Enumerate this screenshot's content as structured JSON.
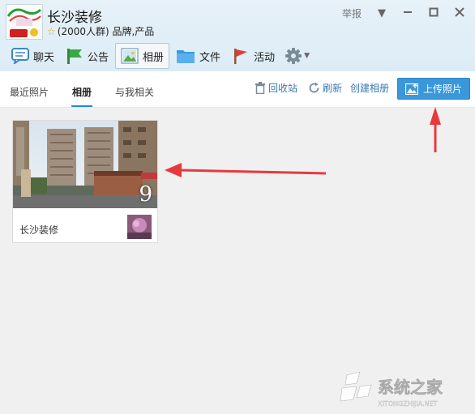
{
  "header": {
    "group_name": "长沙装修",
    "group_meta": "(2000人群) 品牌,产品",
    "report_label": "举报"
  },
  "toolbar": {
    "items": [
      {
        "label": "聊天"
      },
      {
        "label": "公告"
      },
      {
        "label": "相册"
      },
      {
        "label": "文件"
      },
      {
        "label": "活动"
      }
    ]
  },
  "subnav": {
    "tabs": [
      {
        "label": "最近照片"
      },
      {
        "label": "相册"
      },
      {
        "label": "与我相关"
      }
    ],
    "actions": {
      "recycle": "回收站",
      "refresh": "刷新",
      "create_album": "创建相册",
      "upload": "上传照片"
    }
  },
  "albums": [
    {
      "title": "长沙装修",
      "count": "9"
    }
  ],
  "watermark": {
    "logo_text": "系统之家",
    "logo_subtext": "XITONGZHIJIA.NET"
  },
  "colors": {
    "accent": "#3a97da",
    "link": "#3a78b0",
    "arrow": "#e8393c"
  }
}
